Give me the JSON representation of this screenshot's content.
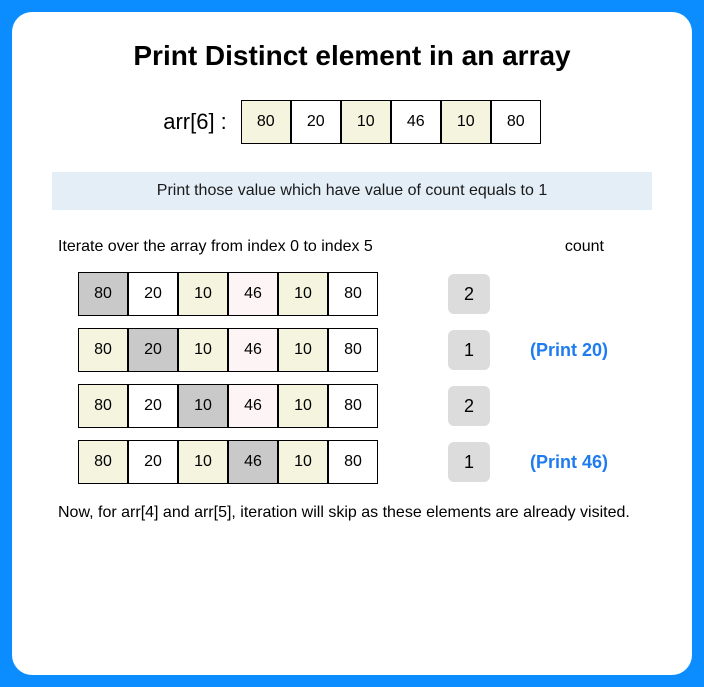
{
  "title": "Print Distinct element in an array",
  "arr_label": "arr[6] :",
  "top_array": [
    "80",
    "20",
    "10",
    "46",
    "10",
    "80"
  ],
  "top_tints": [
    true,
    false,
    true,
    false,
    true,
    false
  ],
  "note": "Print those value which have value of count equals to 1",
  "iterate_label": "Iterate over the array from index 0 to index 5",
  "count_header": "count",
  "rows": [
    {
      "cells": [
        "80",
        "20",
        "10",
        "46",
        "10",
        "80"
      ],
      "highlight": 0,
      "count": "2",
      "print": ""
    },
    {
      "cells": [
        "80",
        "20",
        "10",
        "46",
        "10",
        "80"
      ],
      "highlight": 1,
      "count": "1",
      "print": "(Print 20)"
    },
    {
      "cells": [
        "80",
        "20",
        "10",
        "46",
        "10",
        "80"
      ],
      "highlight": 2,
      "count": "2",
      "print": ""
    },
    {
      "cells": [
        "80",
        "20",
        "10",
        "46",
        "10",
        "80"
      ],
      "highlight": 3,
      "count": "1",
      "print": "(Print 46)"
    }
  ],
  "footer": "Now, for arr[4] and arr[5], iteration will skip as these elements are already visited.",
  "chart_data": {
    "type": "table",
    "title": "Print Distinct element in an array",
    "array_name": "arr[6]",
    "array_values": [
      80,
      20,
      10,
      46,
      10,
      80
    ],
    "iterations": [
      {
        "index": 0,
        "value": 80,
        "count": 2,
        "print": null
      },
      {
        "index": 1,
        "value": 20,
        "count": 1,
        "print": 20
      },
      {
        "index": 2,
        "value": 10,
        "count": 2,
        "print": null
      },
      {
        "index": 3,
        "value": 46,
        "count": 1,
        "print": 46
      }
    ],
    "note": "arr[4] and arr[5] skipped as already visited"
  }
}
